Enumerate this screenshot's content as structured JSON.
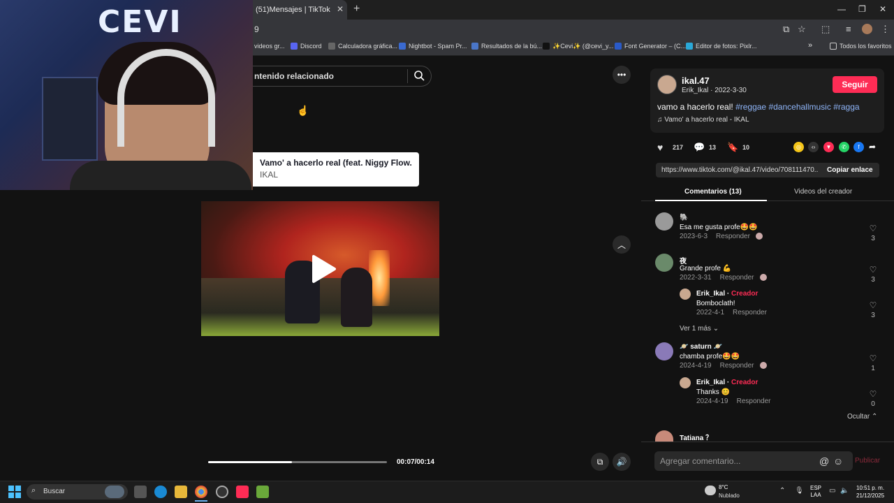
{
  "browser": {
    "tab_title": "(51)Mensajes | TikTok",
    "tab_close": "✕",
    "new_tab": "+",
    "address_fragment": "9",
    "bookmarks": [
      {
        "label": "videos gr...",
        "color": "#444"
      },
      {
        "label": "Discord",
        "color": "#5865f2"
      },
      {
        "label": "Calculadora gráfica...",
        "color": "#666"
      },
      {
        "label": "Nightbot - Spam Pr...",
        "color": "#3a6ad0"
      },
      {
        "label": "Resultados de la bú...",
        "color": "#4a76c8"
      },
      {
        "label": "✨Cevi✨ (@cevi_y...",
        "color": "#111"
      },
      {
        "label": "Font Generator – (C...",
        "color": "#2a5ac8"
      },
      {
        "label": "Editor de fotos: Pixlr...",
        "color": "#2aa8d8"
      }
    ],
    "bookmarks_overflow": "»",
    "all_bookmarks": "Todos los favoritos"
  },
  "webcam": {
    "logo_text": "CEVI"
  },
  "search": {
    "text": "ntenido relacionado"
  },
  "song_card": {
    "title": "Vamo' a hacerlo real (feat. Niggy Flow...",
    "artist": "IKAL"
  },
  "player": {
    "time": "00:07/00:14",
    "progress": 0.47
  },
  "post": {
    "author": "ikal.47",
    "author_sub": "Erik_Ikal · 2022-3-30",
    "follow": "Seguir",
    "desc_text": "vamo a hacerlo real! ",
    "hashtags": [
      "#reggae",
      "#dancehallmusic",
      "#ragga"
    ],
    "music": "Vamo' a hacerlo real - IKAL",
    "likes": "217",
    "comments": "13",
    "saves": "10",
    "share_colors": [
      "#f5c518",
      "#333",
      "#fe2c55",
      "#25d366",
      "#1877f2"
    ],
    "link": "https://www.tiktok.com/@ikal.47/video/708111470...",
    "copy_link": "Copiar enlace"
  },
  "tabs": {
    "comments": "Comentarios (13)",
    "creator_videos": "Videos del creador"
  },
  "comments": [
    {
      "name": "🐘",
      "text": "Esa me gusta profe🤩🤩",
      "date": "2023-6-3",
      "reply": "Responder",
      "likes": "3"
    },
    {
      "name": "夜",
      "text": "Grande profe 💪",
      "date": "2022-3-31",
      "reply": "Responder",
      "likes": "3"
    },
    {
      "name": "Erik_Ikal",
      "creator": "Creador",
      "text": "Bomboclath!",
      "date": "2022-4-1",
      "reply": "Responder",
      "likes": "3"
    },
    {
      "name": "🪐 saturn 🪐",
      "text": "chamba profe🤩🤩",
      "date": "2024-4-19",
      "reply": "Responder",
      "likes": "1"
    },
    {
      "name": "Erik_Ikal",
      "creator": "Creador",
      "text": "Thanks 😊",
      "date": "2024-4-19",
      "reply": "Responder",
      "likes": "0"
    },
    {
      "name": "Tatiana ？"
    }
  ],
  "more_replies": "Ver 1 más ⌄",
  "hide_replies": "Ocultar ⌃",
  "comment_input": {
    "placeholder": "Agregar comentario...",
    "post": "Publicar"
  },
  "taskbar": {
    "search": "Buscar",
    "weather_temp": "8°C",
    "weather_desc": "Nublado",
    "lang_1": "ESP",
    "lang_2": "LAA",
    "time": "10:51 p. m.",
    "date": "21/12/2025"
  }
}
